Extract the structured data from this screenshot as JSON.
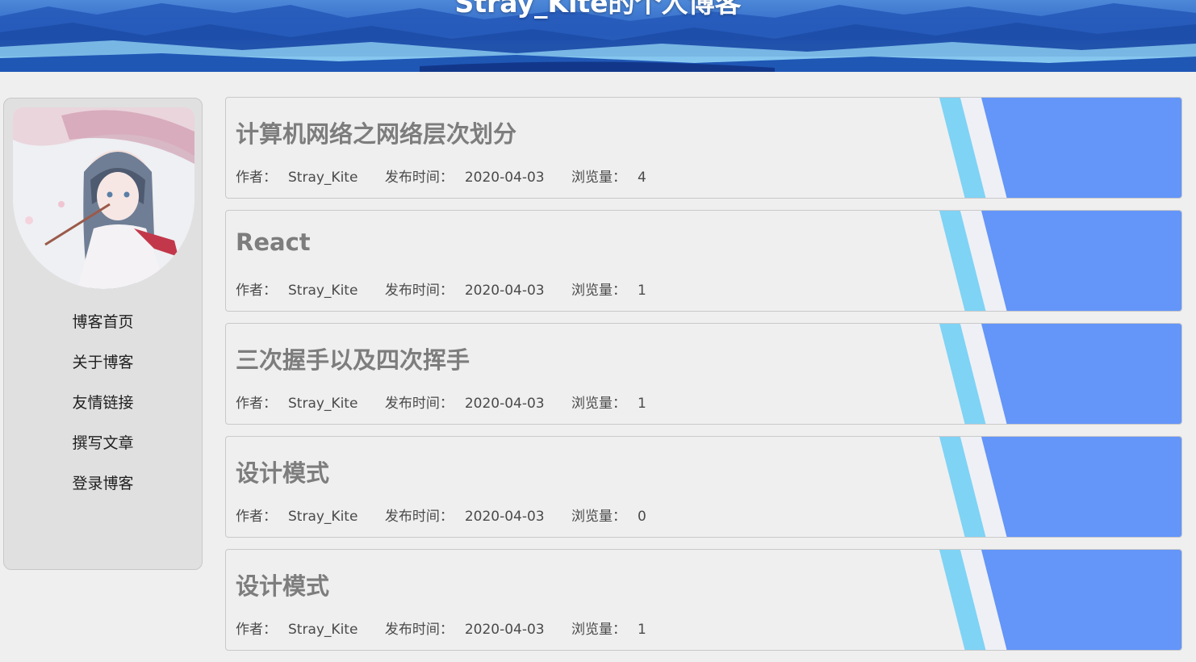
{
  "header": {
    "title": "Stray_Kite的个人博客"
  },
  "sidebar": {
    "avatar": "anime-girl-avatar",
    "nav": [
      {
        "label": "博客首页"
      },
      {
        "label": "关于博客"
      },
      {
        "label": "友情链接"
      },
      {
        "label": "撰写文章"
      },
      {
        "label": "登录博客"
      }
    ]
  },
  "labels": {
    "author": "作者：",
    "date": "发布时间：",
    "views": "浏览量："
  },
  "posts": [
    {
      "title": "计算机网络之网络层次划分",
      "author": "Stray_Kite",
      "date": "2020-04-03",
      "views": "4"
    },
    {
      "title": "React",
      "author": "Stray_Kite",
      "date": "2020-04-03",
      "views": "1"
    },
    {
      "title": "三次握手以及四次挥手",
      "author": "Stray_Kite",
      "date": "2020-04-03",
      "views": "1"
    },
    {
      "title": "设计模式",
      "author": "Stray_Kite",
      "date": "2020-04-03",
      "views": "0"
    },
    {
      "title": "设计模式",
      "author": "Stray_Kite",
      "date": "2020-04-03",
      "views": "1"
    }
  ],
  "colors": {
    "accent_blue": "#6495f8",
    "stripe_light": "#7fd3f5",
    "stripe_white": "#f2f2f2"
  }
}
